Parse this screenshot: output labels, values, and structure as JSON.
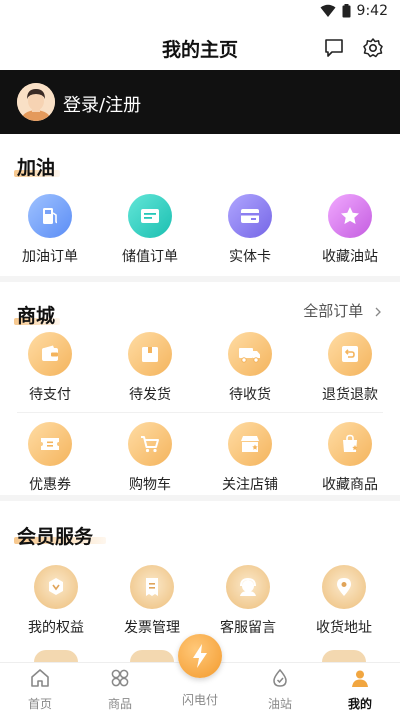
{
  "status_bar": {
    "time": "9:42"
  },
  "header": {
    "title": "我的主页"
  },
  "login": {
    "text": "登录/注册"
  },
  "fuel": {
    "title": "加油",
    "items": [
      {
        "label": "加油订单",
        "icon": "fuel-pump-icon",
        "color": "#6f9af7"
      },
      {
        "label": "储值订单",
        "icon": "stored-value-card-icon",
        "color": "#25c7b8"
      },
      {
        "label": "实体卡",
        "icon": "physical-card-icon",
        "color": "#7f70ea"
      },
      {
        "label": "收藏油站",
        "icon": "star-icon",
        "color": "#cf6ae6"
      }
    ]
  },
  "mall": {
    "title": "商城",
    "all_orders": "全部订单",
    "items": [
      {
        "label": "待支付",
        "icon": "wallet-icon"
      },
      {
        "label": "待发货",
        "icon": "box-icon"
      },
      {
        "label": "待收货",
        "icon": "truck-icon"
      },
      {
        "label": "退货退款",
        "icon": "return-icon"
      },
      {
        "label": "优惠券",
        "icon": "coupon-icon"
      },
      {
        "label": "购物车",
        "icon": "cart-icon"
      },
      {
        "label": "关注店铺",
        "icon": "store-star-icon"
      },
      {
        "label": "收藏商品",
        "icon": "bag-star-icon"
      }
    ]
  },
  "member": {
    "title": "会员服务",
    "items": [
      {
        "label": "我的权益",
        "icon": "rights-badge-icon"
      },
      {
        "label": "发票管理",
        "icon": "invoice-icon"
      },
      {
        "label": "客服留言",
        "icon": "customer-service-icon"
      },
      {
        "label": "收货地址",
        "icon": "location-pin-icon"
      }
    ]
  },
  "tabbar": {
    "items": [
      {
        "label": "首页",
        "icon": "home-icon"
      },
      {
        "label": "商品",
        "icon": "products-icon"
      },
      {
        "label": "闪电付",
        "icon": "lightning-icon"
      },
      {
        "label": "油站",
        "icon": "gas-station-icon"
      },
      {
        "label": "我的",
        "icon": "profile-icon"
      }
    ],
    "active": "我的"
  },
  "colors": {
    "accent": "#f4b45d",
    "dark_bar": "#111111"
  }
}
